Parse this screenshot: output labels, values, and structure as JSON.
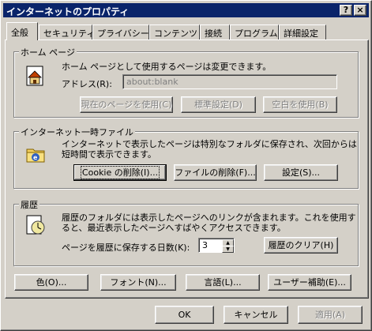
{
  "window": {
    "title": "インターネットのプロパティ",
    "help_label": "?",
    "close_label": "×"
  },
  "tabs": [
    {
      "label": "全般"
    },
    {
      "label": "セキュリティ"
    },
    {
      "label": "プライバシー"
    },
    {
      "label": "コンテンツ"
    },
    {
      "label": "接続"
    },
    {
      "label": "プログラム"
    },
    {
      "label": "詳細設定"
    }
  ],
  "home_page": {
    "group_label": "ホーム ページ",
    "description": "ホーム ページとして使用するページは変更できます。",
    "address_label": "アドレス(R):",
    "address_value": "about:blank",
    "use_current_label": "現在のページを使用(C)",
    "use_default_label": "標準設定(D)",
    "use_blank_label": "空白を使用(B)"
  },
  "temp_files": {
    "group_label": "インターネット一時ファイル",
    "description_line1": "インターネットで表示したページは特別なフォルダに保存され、次回からは",
    "description_line2": "短時間で表示できます。",
    "delete_cookies_label": "Cookie の削除(I)...",
    "delete_files_label": "ファイルの削除(F)...",
    "settings_label": "設定(S)..."
  },
  "history": {
    "group_label": "履歴",
    "description_line1": "履歴のフォルダには表示したページへのリンクが含まれます。これを使用す",
    "description_line2": "ると、最近表示したページへすばやくアクセスできます。",
    "days_label": "ページを履歴に保存する日数(K):",
    "days_value": "3",
    "clear_label": "履歴のクリア(H)"
  },
  "bottom_buttons": {
    "colors_label": "色(O)...",
    "fonts_label": "フォント(N)...",
    "languages_label": "言語(L)...",
    "accessibility_label": "ユーザー補助(E)..."
  },
  "dialog_buttons": {
    "ok_label": "OK",
    "cancel_label": "キャンセル",
    "apply_label": "適用(A)"
  }
}
